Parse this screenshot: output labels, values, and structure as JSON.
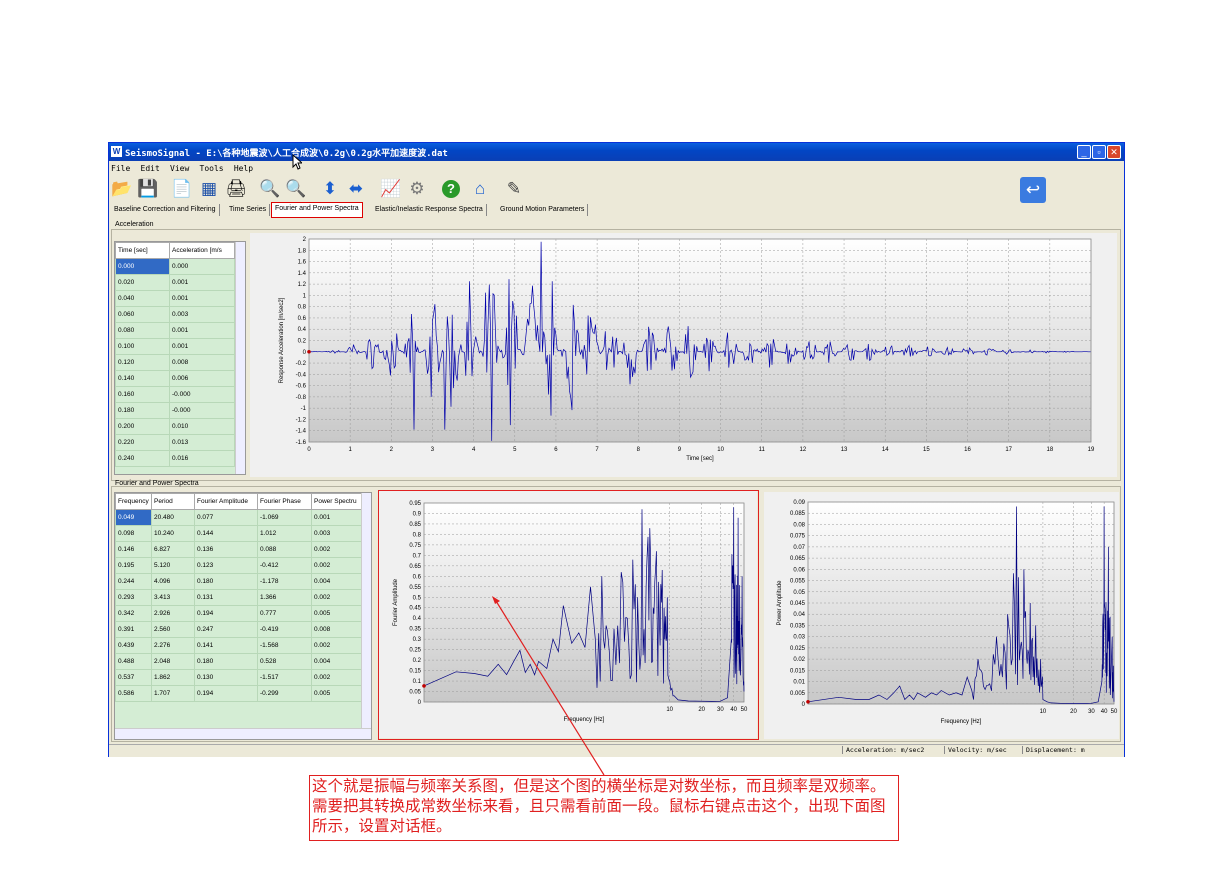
{
  "window": {
    "title": "SeismoSignal - E:\\各种地震波\\人工合成波\\0.2g\\0.2g水平加速度波.dat",
    "controls": [
      "_",
      "▫",
      "✕"
    ]
  },
  "menu": [
    "File",
    "Edit",
    "View",
    "Tools",
    "Help"
  ],
  "toolbar": {
    "icons": [
      "open-folder",
      "save",
      "new-document",
      "waveform",
      "print",
      "zoom-in",
      "zoom-out",
      "vertical-arrows",
      "horizontal-arrows",
      "chart",
      "settings",
      "help",
      "home",
      "notes",
      "back"
    ],
    "glyphs": [
      "📂",
      "💾",
      "📄",
      "▦",
      "🖨",
      "🔍",
      "🔍",
      "⬍",
      "⬌",
      "📈",
      "⚙",
      "?",
      "⌂",
      "✎",
      "↩"
    ]
  },
  "tabs": [
    "Baseline Correction and Filtering",
    "Time Series",
    "Fourier and Power Spectra",
    "Elastic/Inelastic Response Spectra",
    "Ground Motion Parameters"
  ],
  "active_tab": 2,
  "acceleration": {
    "group_label": "Acceleration",
    "columns": [
      "Time [sec]",
      "Acceleration [m/s"
    ],
    "rows": [
      [
        "0.000",
        "0.000"
      ],
      [
        "0.020",
        "0.001"
      ],
      [
        "0.040",
        "0.001"
      ],
      [
        "0.060",
        "0.003"
      ],
      [
        "0.080",
        "0.001"
      ],
      [
        "0.100",
        "0.001"
      ],
      [
        "0.120",
        "0.008"
      ],
      [
        "0.140",
        "0.006"
      ],
      [
        "0.160",
        "-0.000"
      ],
      [
        "0.180",
        "-0.000"
      ],
      [
        "0.200",
        "0.010"
      ],
      [
        "0.220",
        "0.013"
      ],
      [
        "0.240",
        "0.016"
      ]
    ]
  },
  "spectra": {
    "group_label": "Fourier and Power Spectra",
    "columns": [
      "Frequency",
      "Period",
      "Fourier Amplitude",
      "Fourier Phase",
      "Power Spectru"
    ],
    "rows": [
      [
        "0.049",
        "20.480",
        "0.077",
        "-1.069",
        "0.001"
      ],
      [
        "0.098",
        "10.240",
        "0.144",
        "1.012",
        "0.003"
      ],
      [
        "0.146",
        "6.827",
        "0.136",
        "0.088",
        "0.002"
      ],
      [
        "0.195",
        "5.120",
        "0.123",
        "-0.412",
        "0.002"
      ],
      [
        "0.244",
        "4.096",
        "0.180",
        "-1.178",
        "0.004"
      ],
      [
        "0.293",
        "3.413",
        "0.131",
        "1.366",
        "0.002"
      ],
      [
        "0.342",
        "2.926",
        "0.194",
        "0.777",
        "0.005"
      ],
      [
        "0.391",
        "2.560",
        "0.247",
        "-0.419",
        "0.008"
      ],
      [
        "0.439",
        "2.276",
        "0.141",
        "-1.568",
        "0.002"
      ],
      [
        "0.488",
        "2.048",
        "0.180",
        "0.528",
        "0.004"
      ],
      [
        "0.537",
        "1.862",
        "0.130",
        "-1.517",
        "0.002"
      ],
      [
        "0.586",
        "1.707",
        "0.194",
        "-0.299",
        "0.005"
      ]
    ]
  },
  "chart_data": [
    {
      "type": "line",
      "xlabel": "Time [sec]",
      "ylabel": "Response Acceleration [m/sec2]",
      "xlim": [
        0,
        19
      ],
      "ylim": [
        -1.6,
        2
      ],
      "xticks": [
        0,
        1,
        2,
        3,
        4,
        5,
        6,
        7,
        8,
        9,
        10,
        11,
        12,
        13,
        14,
        15,
        16,
        17,
        18,
        19
      ],
      "yticks": [
        2,
        1.8,
        1.6,
        1.4,
        1.2,
        1,
        0.8,
        0.6,
        0.4,
        0.2,
        0,
        -0.2,
        -0.4,
        -0.6,
        -0.8,
        -1,
        -1.2,
        -1.4,
        -1.6
      ],
      "grid": true,
      "color": "#0000aa",
      "envelope": {
        "t": [
          0,
          0.6,
          1.0,
          2.0,
          3.0,
          4.0,
          5.0,
          6.0,
          7.0,
          8.0,
          9.0,
          10.0,
          11.0,
          12.0,
          13.0,
          14.0,
          15.0,
          16.0,
          17.0,
          18.0,
          19.0
        ],
        "a": [
          0.0,
          0.02,
          0.1,
          0.4,
          0.8,
          1.2,
          1.3,
          1.1,
          0.75,
          0.55,
          0.45,
          0.35,
          0.25,
          0.2,
          0.15,
          0.12,
          0.1,
          0.07,
          0.04,
          0.02,
          0.0
        ]
      },
      "peaks": [
        [
          2.55,
          -1.38
        ],
        [
          4.45,
          -1.58
        ],
        [
          4.3,
          1.05
        ],
        [
          5.65,
          1.95
        ],
        [
          5.9,
          1.25
        ],
        [
          3.3,
          -1.38
        ],
        [
          4.9,
          -1.3
        ]
      ]
    },
    {
      "type": "line",
      "xlabel": "Frequency [Hz]",
      "ylabel": "Fourier Amplitude",
      "xscale": "log",
      "xlim": [
        0.049,
        50
      ],
      "ylim": [
        0,
        0.95
      ],
      "xticks": [
        10,
        20,
        30,
        40,
        50
      ],
      "yticks": [
        0.95,
        0.9,
        0.85,
        0.8,
        0.75,
        0.7,
        0.65,
        0.6,
        0.55,
        0.5,
        0.45,
        0.4,
        0.35,
        0.3,
        0.25,
        0.2,
        0.15,
        0.1,
        0.05,
        0
      ],
      "ytick_labels": [
        "0.95",
        "0.9",
        "0.85",
        "0.8",
        "0.75",
        "0.7",
        "0.65",
        "0.6",
        "0.55",
        "0.5",
        "0.45",
        "0.4",
        "0.35",
        "0.3",
        "0.25",
        "0.2",
        "0.15",
        "0.1",
        "0.05",
        "0"
      ],
      "grid": true,
      "color": "#000080",
      "x": [
        0.049,
        0.098,
        0.146,
        0.195,
        0.244,
        0.293,
        0.342,
        0.391,
        0.439,
        0.488,
        0.537,
        0.586,
        0.7,
        0.8,
        0.9,
        1.0,
        1.2,
        1.4,
        1.6,
        1.8,
        2.0,
        2.3,
        2.6,
        3.0,
        3.5,
        4.0,
        4.5,
        5.0,
        5.5,
        6.0,
        6.5,
        7.0,
        7.5,
        8.0,
        8.5,
        9.0,
        9.5,
        10.0,
        11.0,
        12.0,
        15.0,
        20.0,
        25.0,
        30.0,
        35.0,
        38.0,
        40.0,
        42.0,
        44.0,
        46.0,
        48.0,
        50.0
      ],
      "y": [
        0.077,
        0.144,
        0.136,
        0.123,
        0.18,
        0.131,
        0.194,
        0.247,
        0.141,
        0.18,
        0.13,
        0.194,
        0.16,
        0.3,
        0.24,
        0.46,
        0.28,
        0.33,
        0.26,
        0.55,
        0.3,
        0.6,
        0.34,
        0.35,
        0.62,
        0.4,
        0.68,
        0.5,
        0.92,
        0.55,
        0.83,
        0.45,
        0.72,
        0.38,
        0.63,
        0.3,
        0.5,
        0.1,
        0.03,
        0.01,
        0.005,
        0.004,
        0.003,
        0.004,
        0.02,
        0.3,
        0.93,
        0.2,
        0.88,
        0.15,
        0.6,
        0.05
      ]
    },
    {
      "type": "line",
      "xlabel": "Frequency [Hz]",
      "ylabel": "Power Amplitude",
      "xscale": "log",
      "xlim": [
        0.049,
        50
      ],
      "ylim": [
        0,
        0.09
      ],
      "xticks": [
        10,
        20,
        30,
        40,
        50
      ],
      "yticks": [
        0.09,
        0.085,
        0.08,
        0.075,
        0.07,
        0.065,
        0.06,
        0.055,
        0.05,
        0.045,
        0.04,
        0.035,
        0.03,
        0.025,
        0.02,
        0.015,
        0.01,
        0.005,
        0
      ],
      "ytick_labels": [
        "0.09",
        "0.085",
        "0.08",
        "0.075",
        "0.07",
        "0.065",
        "0.06",
        "0.055",
        "0.05",
        "0.045",
        "0.04",
        "0.035",
        "0.03",
        "0.025",
        "0.02",
        "0.015",
        "0.01",
        "0.005",
        "0"
      ],
      "grid": true,
      "color": "#000080",
      "x": [
        0.049,
        0.098,
        0.146,
        0.195,
        0.244,
        0.293,
        0.342,
        0.391,
        0.439,
        0.488,
        0.537,
        0.586,
        0.7,
        0.8,
        0.9,
        1.0,
        1.2,
        1.4,
        1.6,
        1.8,
        2.0,
        2.3,
        2.6,
        3.0,
        3.5,
        4.0,
        4.5,
        5.0,
        5.5,
        6.0,
        6.5,
        7.0,
        7.5,
        8.0,
        8.5,
        9.0,
        9.5,
        10.0,
        11.0,
        12.0,
        15.0,
        20.0,
        25.0,
        30.0,
        35.0,
        38.0,
        40.0,
        42.0,
        44.0,
        46.0,
        48.0,
        50.0
      ],
      "y": [
        0.001,
        0.003,
        0.002,
        0.002,
        0.004,
        0.002,
        0.005,
        0.008,
        0.002,
        0.004,
        0.002,
        0.005,
        0.003,
        0.005,
        0.004,
        0.006,
        0.004,
        0.005,
        0.004,
        0.012,
        0.006,
        0.02,
        0.008,
        0.009,
        0.03,
        0.012,
        0.04,
        0.02,
        0.088,
        0.025,
        0.06,
        0.018,
        0.045,
        0.012,
        0.035,
        0.008,
        0.02,
        0.002,
        0.001,
        0.0005,
        0.0003,
        0.0002,
        0.0002,
        0.0003,
        0.001,
        0.01,
        0.088,
        0.005,
        0.07,
        0.004,
        0.03,
        0.001
      ]
    }
  ],
  "status": [
    "Acceleration: m/sec2",
    "Velocity: m/sec",
    "Displacement: m"
  ],
  "annotation": {
    "text": "这个就是振幅与频率关系图，但是这个图的横坐标是对数坐标，而且频率是双频率。需要把其转换成常数坐标来看，且只需看前面一段。鼠标右键点击这个，出现下面图所示，设置对话框。",
    "color": "#e02020"
  }
}
